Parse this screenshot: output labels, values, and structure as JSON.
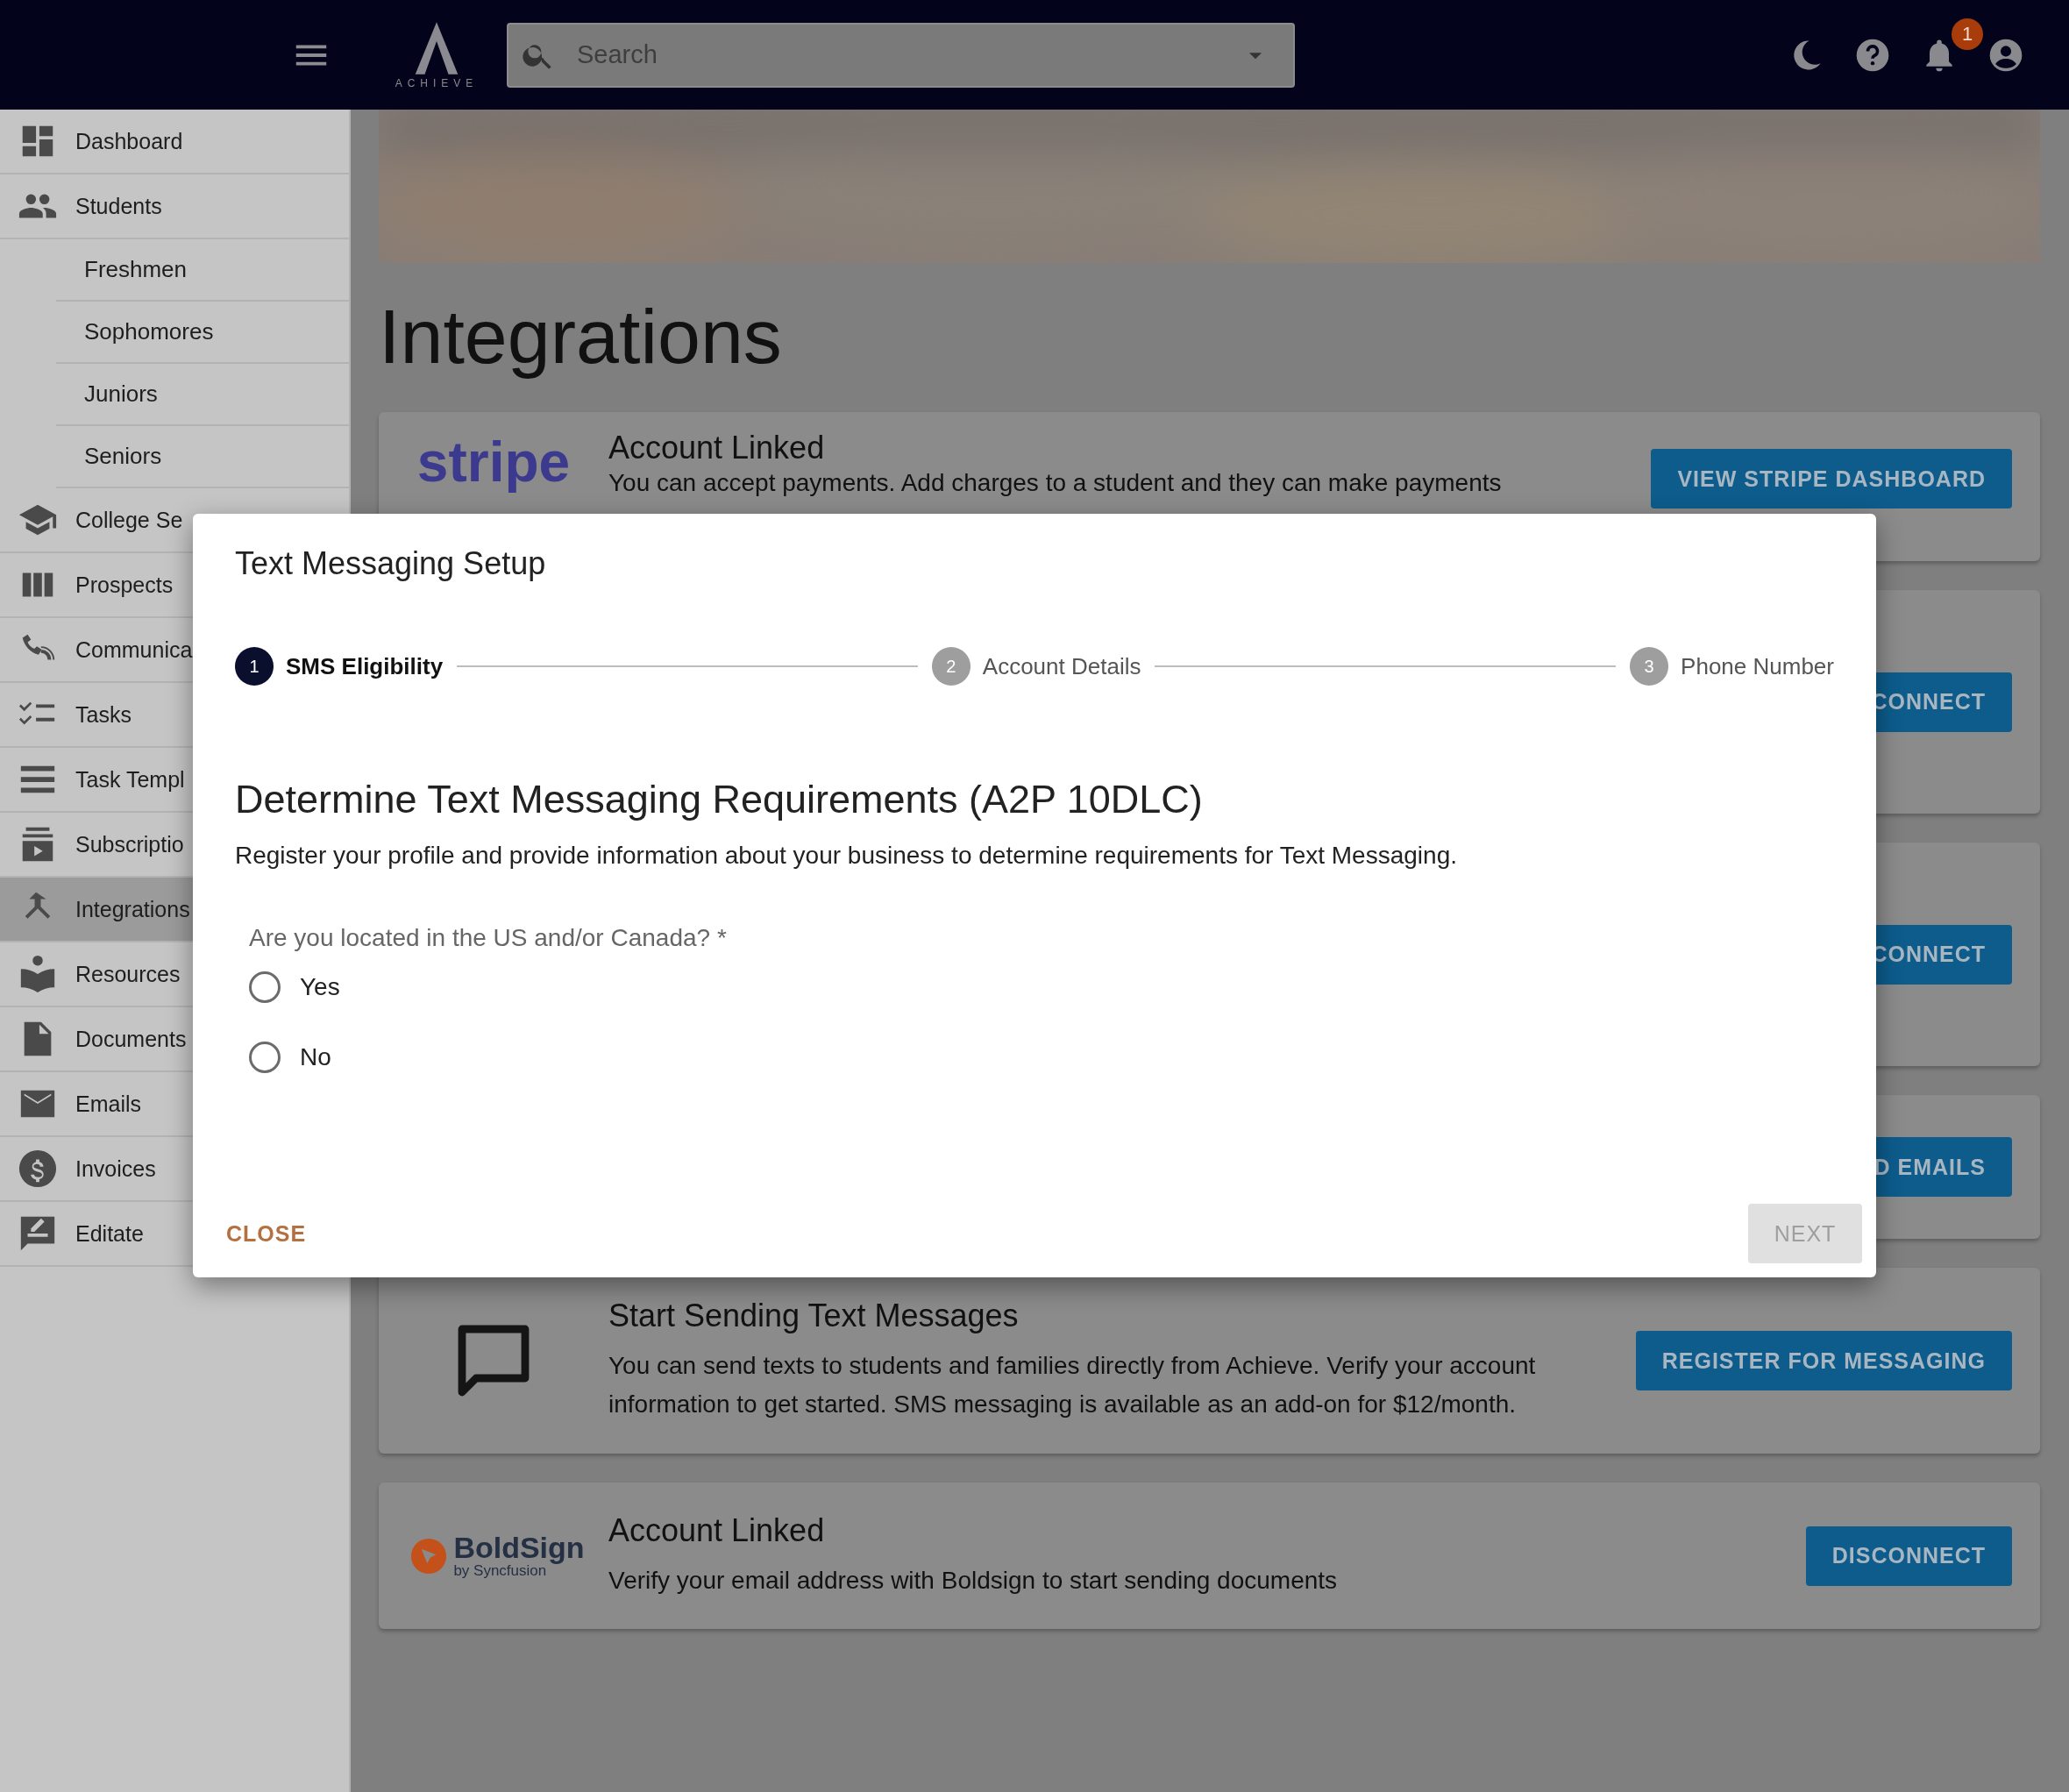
{
  "topbar": {
    "logo_text": "ACHIEVE",
    "search": {
      "placeholder": "Search"
    },
    "notification_count": "1"
  },
  "sidebar": {
    "items": [
      {
        "label": "Dashboard",
        "selected": false
      },
      {
        "label": "Students",
        "selected": false,
        "children": [
          {
            "label": "Freshmen",
            "selected": false
          },
          {
            "label": "Sophomores",
            "selected": false
          },
          {
            "label": "Juniors",
            "selected": false
          },
          {
            "label": "Seniors",
            "selected": false
          }
        ]
      },
      {
        "label": "College Se",
        "selected": false
      },
      {
        "label": "Prospects",
        "selected": false
      },
      {
        "label": "Communica",
        "selected": false
      },
      {
        "label": "Tasks",
        "selected": false
      },
      {
        "label": "Task Templ",
        "selected": false
      },
      {
        "label": "Subscriptio",
        "selected": false
      },
      {
        "label": "Integrations",
        "selected": true
      },
      {
        "label": "Resources",
        "selected": false
      },
      {
        "label": "Documents",
        "selected": false
      },
      {
        "label": "Emails",
        "selected": false
      },
      {
        "label": "Invoices",
        "selected": false
      },
      {
        "label": "Editate",
        "selected": false
      }
    ]
  },
  "page_title": "Integrations",
  "cards": [
    {
      "kind": "stripe",
      "logo_text": "stripe",
      "title": "Account Linked",
      "description": "You can accept payments. Add charges to a student and they can make payments",
      "button": "VIEW STRIPE DASHBOARD"
    },
    {
      "kind": "hidden",
      "button": "CONNECT"
    },
    {
      "kind": "hidden",
      "button": "CONNECT"
    },
    {
      "kind": "hidden",
      "button": "D EMAILS"
    },
    {
      "kind": "chat",
      "title": "Start Sending Text Messages",
      "description": "You can send texts to students and families directly from Achieve. Verify your account information to get started. SMS messaging is available as an add-on for $12/month.",
      "button": "REGISTER FOR MESSAGING"
    },
    {
      "kind": "boldsign",
      "logo_text": "BoldSign",
      "logo_subtext": "by Syncfusion",
      "title": "Account Linked",
      "description": "Verify your email address with Boldsign to start sending documents",
      "button": "DISCONNECT"
    }
  ],
  "dialog": {
    "title": "Text Messaging Setup",
    "steps": [
      {
        "number": "1",
        "label": "SMS Eligibility",
        "selected": true
      },
      {
        "number": "2",
        "label": "Account Details",
        "selected": false
      },
      {
        "number": "3",
        "label": "Phone Number",
        "selected": false
      }
    ],
    "heading": "Determine Text Messaging Requirements (A2P 10DLC)",
    "description": "Register your profile and provide information about your business to determine requirements for Text Messaging.",
    "question": "Are you located in the US and/or Canada? *",
    "options": [
      {
        "label": "Yes",
        "selected": false
      },
      {
        "label": "No",
        "selected": false
      }
    ],
    "close_button": "CLOSE",
    "next_button": {
      "label": "NEXT",
      "disabled": true
    }
  }
}
